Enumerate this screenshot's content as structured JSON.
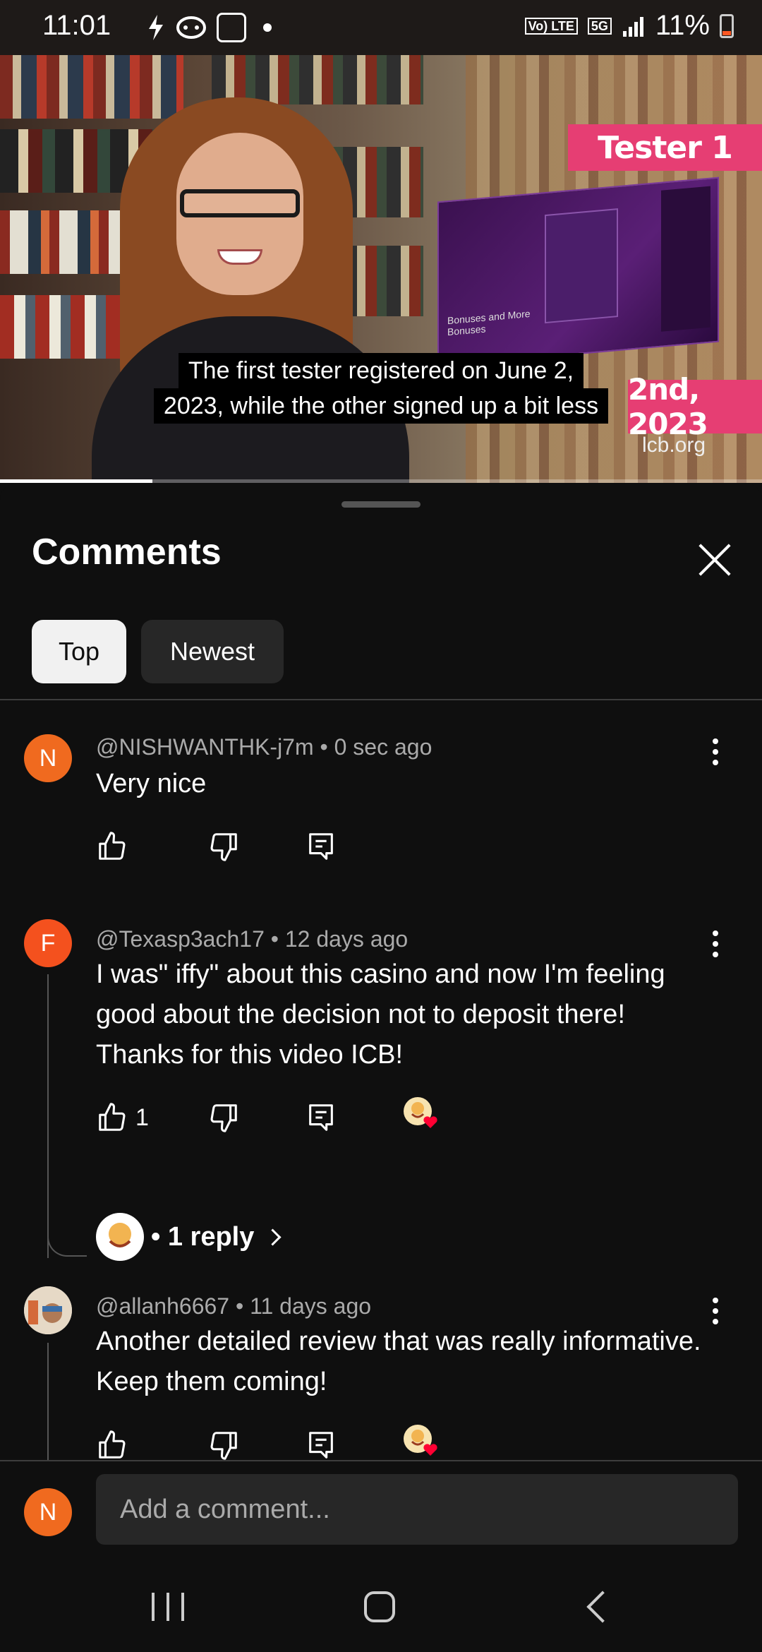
{
  "status_bar": {
    "time": "11:01",
    "network_label": "Vo) LTE",
    "network_type": "5G",
    "battery": "11%",
    "colors": {
      "battery_low": "#ff5722"
    }
  },
  "video": {
    "caption_line1": "The first tester registered on June 2,",
    "caption_line2": "2023, while the other signed up a bit less",
    "overlay_tester": "Tester 1",
    "overlay_date": "2nd, 2023",
    "overlay_site": "lcb.org",
    "screen_text_line1": "Bonuses and More",
    "screen_text_line2": "Bonuses",
    "progress": 0.2
  },
  "comments_sheet": {
    "title": "Comments",
    "sort_options": [
      "Top",
      "Newest"
    ],
    "selected_sort": "Top",
    "comments": [
      {
        "avatar_letter": "N",
        "avatar_color": "#f06a1f",
        "author": "@NISHWANTHK-j7m",
        "time": "0 sec ago",
        "meta": "@NISHWANTHK-j7m • 0 sec ago",
        "text": "Very nice",
        "likes": ""
      },
      {
        "avatar_letter": "F",
        "avatar_color": "#f4511e",
        "author": "@Texasp3ach17",
        "time": "12 days ago",
        "meta": "@Texasp3ach17 • 12 days ago",
        "text": "I was\" iffy\" about this casino and now I'm feeling good about the decision not to deposit there! Thanks for this video ICB!",
        "likes": "1",
        "reply_summary": "• 1 reply"
      },
      {
        "avatar_letter": "",
        "avatar_color": "#d8d8d8",
        "author": "@allanh6667",
        "time": "11 days ago",
        "meta": "@allanh6667 • 11 days ago",
        "text": "Another detailed review that was really informative. Keep them coming!",
        "likes": ""
      }
    ]
  },
  "add_comment": {
    "avatar_letter": "N",
    "placeholder": "Add a comment..."
  },
  "icons": {
    "like": "thumbs-up-icon",
    "dislike": "thumbs-down-icon",
    "reply": "reply-icon",
    "more": "more-vert-icon",
    "close": "close-icon",
    "heart": "creator-heart-icon"
  }
}
